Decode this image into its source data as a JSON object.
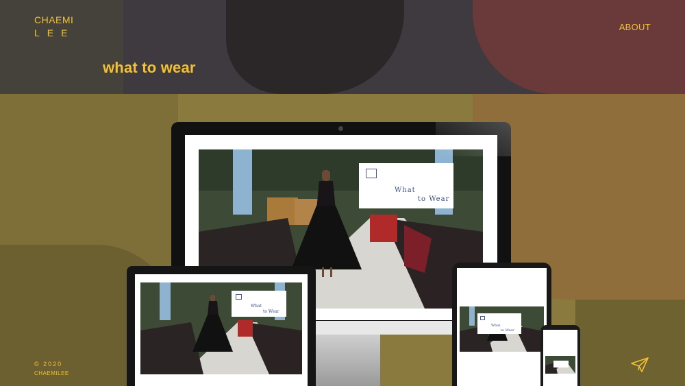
{
  "brand": {
    "line1": "CHAEMI",
    "line2": "LEE"
  },
  "nav": {
    "about_label": "ABOUT"
  },
  "page": {
    "title": "what to wear"
  },
  "footer": {
    "copyright": "© 2020",
    "name": "CHAEMILEE"
  },
  "mockup": {
    "card_line1": "What",
    "card_line2": "to Wear"
  },
  "colors": {
    "accent": "#f2c234",
    "header_bg": "#3f3a3f",
    "body_bg": "#8a7a3e"
  },
  "icons": {
    "send": "paper-plane-icon",
    "hanger": "hanger-icon"
  }
}
